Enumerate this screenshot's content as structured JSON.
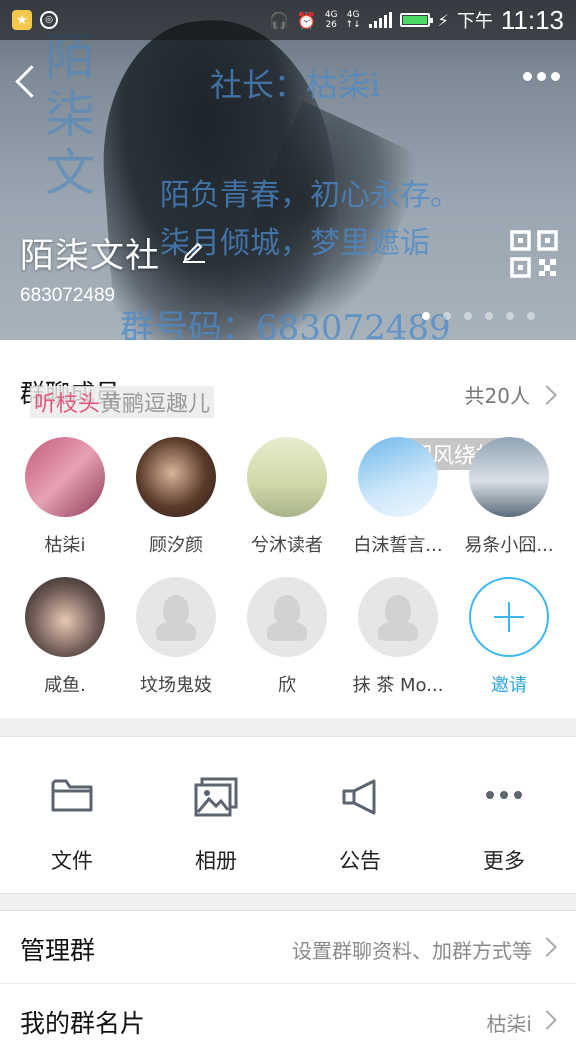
{
  "status_bar": {
    "network": "4G",
    "network2": "4G",
    "signal_label": "26",
    "battery_level": 1.0,
    "ampm": "下午",
    "time": "11:13"
  },
  "header": {
    "group_name": "陌柒文社",
    "group_id": "683072489",
    "bg_lines": [
      "社长：枯柒i",
      "陌负青春，初心永存。",
      "柒月倾城，梦里遮诟",
      "群号码：683072489"
    ],
    "bg_vertical": "陌柒文",
    "page_count": 6,
    "page_active": 0
  },
  "members": {
    "title": "群聊成员",
    "count": "共20人",
    "overlay_a_red": "听枝头",
    "overlay_a_gray": "黄鹂逗趣儿",
    "overlay_b": "细风绕指淌",
    "row1": [
      {
        "name": "枯柒i"
      },
      {
        "name": "顾汐颜"
      },
      {
        "name": "兮沐读者"
      },
      {
        "name": "白沫誓言..."
      },
      {
        "name": "易条小囧..."
      }
    ],
    "row2": [
      {
        "name": "咸鱼."
      },
      {
        "name": "坟场鬼妓"
      },
      {
        "name": "欣"
      },
      {
        "name": "抹 茶 Mo..."
      }
    ],
    "invite_label": "邀请"
  },
  "actions": [
    {
      "label": "文件",
      "icon": "folder-icon"
    },
    {
      "label": "相册",
      "icon": "photo-album-icon"
    },
    {
      "label": "公告",
      "icon": "megaphone-icon"
    },
    {
      "label": "更多",
      "icon": "more-icon"
    }
  ],
  "manage": {
    "title": "管理群",
    "value": "设置群聊资料、加群方式等"
  },
  "card": {
    "title": "我的群名片",
    "value": "枯柒i"
  }
}
